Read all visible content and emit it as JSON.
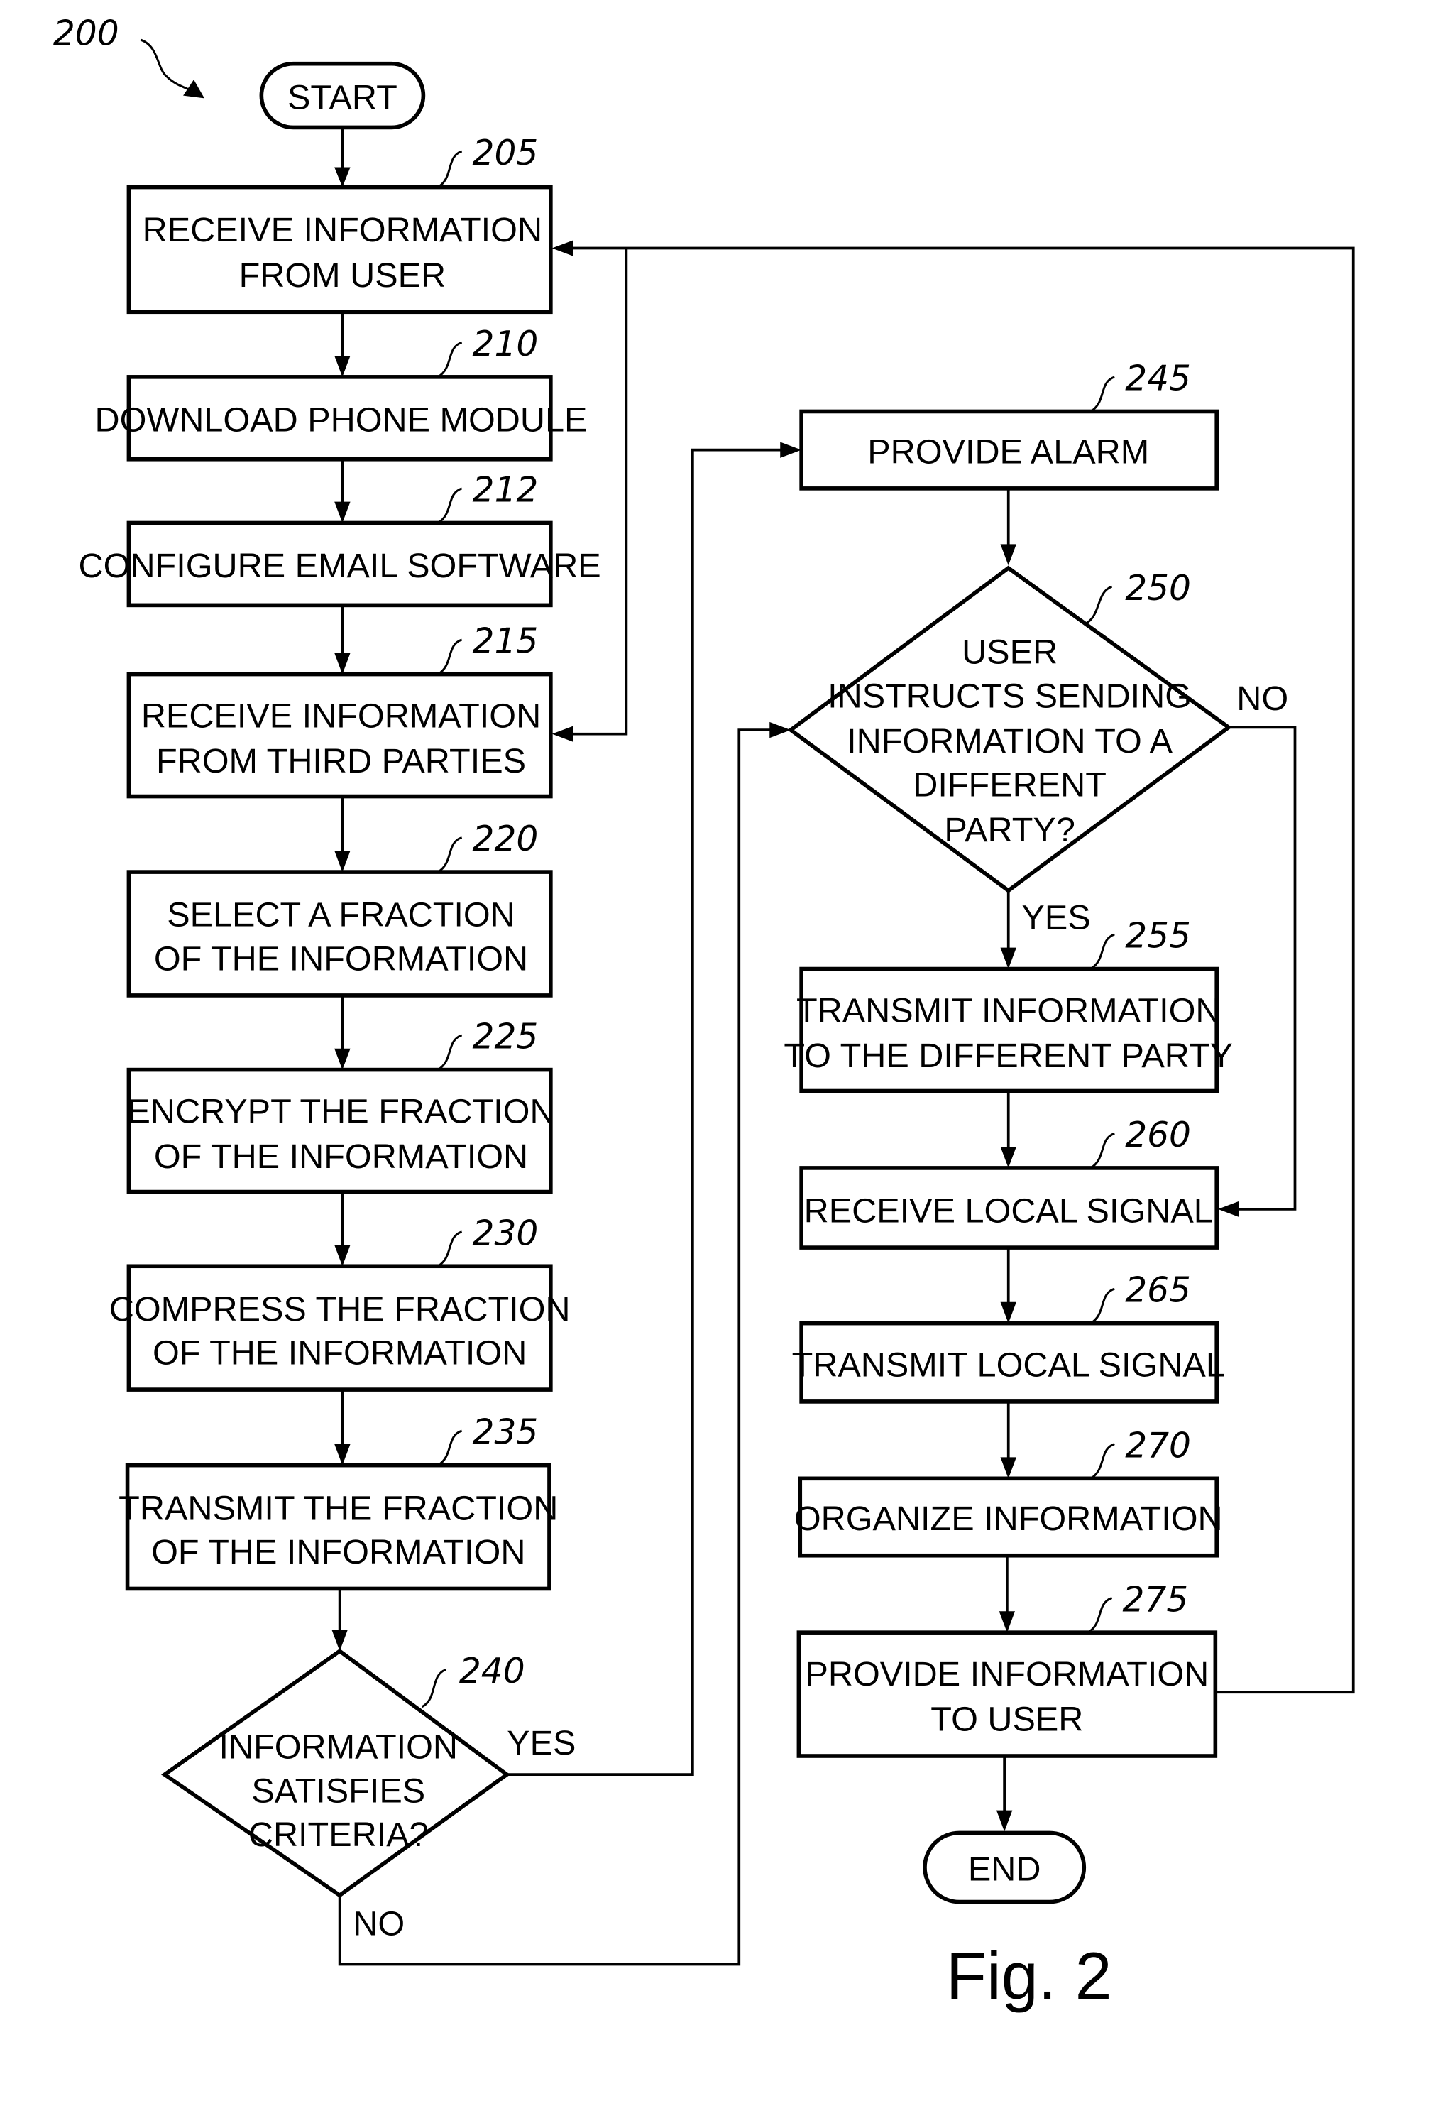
{
  "figure": {
    "ref": "200",
    "caption": "Fig. 2"
  },
  "terminals": {
    "start": "START",
    "end": "END"
  },
  "steps": {
    "s205": {
      "ref": "205",
      "lines": [
        "RECEIVE INFORMATION",
        "FROM USER"
      ]
    },
    "s210": {
      "ref": "210",
      "lines": [
        "DOWNLOAD PHONE MODULE"
      ]
    },
    "s212": {
      "ref": "212",
      "lines": [
        "CONFIGURE EMAIL SOFTWARE"
      ]
    },
    "s215": {
      "ref": "215",
      "lines": [
        "RECEIVE INFORMATION",
        "FROM THIRD PARTIES"
      ]
    },
    "s220": {
      "ref": "220",
      "lines": [
        "SELECT A FRACTION",
        "OF THE INFORMATION"
      ]
    },
    "s225": {
      "ref": "225",
      "lines": [
        "ENCRYPT THE FRACTION",
        "OF THE INFORMATION"
      ]
    },
    "s230": {
      "ref": "230",
      "lines": [
        "COMPRESS THE FRACTION",
        "OF THE INFORMATION"
      ]
    },
    "s235": {
      "ref": "235",
      "lines": [
        "TRANSMIT THE FRACTION",
        "OF THE INFORMATION"
      ]
    },
    "s245": {
      "ref": "245",
      "lines": [
        "PROVIDE ALARM"
      ]
    },
    "s255": {
      "ref": "255",
      "lines": [
        "TRANSMIT INFORMATION",
        "TO THE DIFFERENT PARTY"
      ]
    },
    "s260": {
      "ref": "260",
      "lines": [
        "RECEIVE LOCAL SIGNAL"
      ]
    },
    "s265": {
      "ref": "265",
      "lines": [
        "TRANSMIT LOCAL SIGNAL"
      ]
    },
    "s270": {
      "ref": "270",
      "lines": [
        "ORGANIZE INFORMATION"
      ]
    },
    "s275": {
      "ref": "275",
      "lines": [
        "PROVIDE INFORMATION",
        "TO USER"
      ]
    }
  },
  "decisions": {
    "d240": {
      "ref": "240",
      "lines": [
        "INFORMATION",
        "SATISFIES",
        "CRITERIA?"
      ],
      "yes": "YES",
      "no": "NO"
    },
    "d250": {
      "ref": "250",
      "lines": [
        "USER",
        "INSTRUCTS SENDING",
        "INFORMATION TO A",
        "DIFFERENT",
        "PARTY?"
      ],
      "yes": "YES",
      "no": "NO"
    }
  }
}
